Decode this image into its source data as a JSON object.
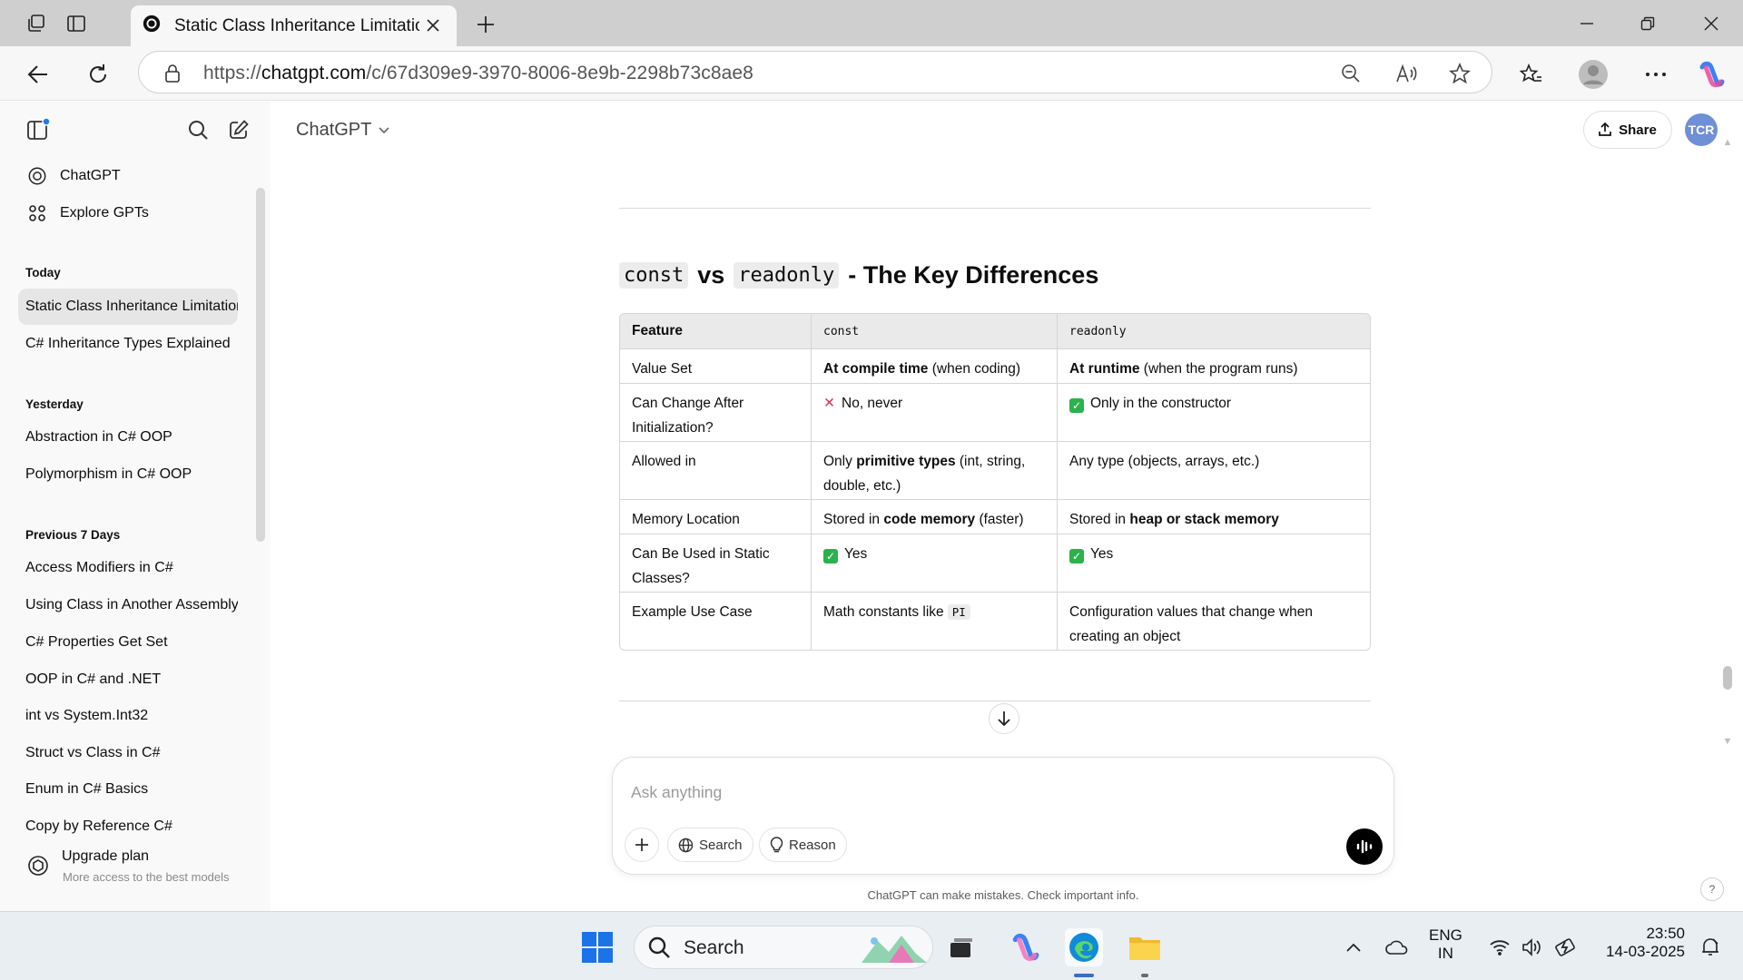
{
  "browser": {
    "tab_title": "Static Class Inheritance Limitation",
    "url_prefix": "https://",
    "url_host": "chatgpt.com",
    "url_path": "/c/67d309e9-3970-8006-8e9b-2298b73c8ae8"
  },
  "sidebar": {
    "nav": [
      {
        "label": "ChatGPT",
        "icon": "openai-logo-icon"
      },
      {
        "label": "Explore GPTs",
        "icon": "grid-icon"
      }
    ],
    "sections": [
      {
        "title": "Today",
        "items": [
          "Static Class Inheritance Limitation",
          "C# Inheritance Types Explained"
        ]
      },
      {
        "title": "Yesterday",
        "items": [
          "Abstraction in C# OOP",
          "Polymorphism in C# OOP"
        ]
      },
      {
        "title": "Previous 7 Days",
        "items": [
          "Access Modifiers in C#",
          "Using Class in Another Assembly",
          "C# Properties Get Set",
          "OOP in C# and .NET",
          "int vs System.Int32",
          "Struct vs Class in C#",
          "Enum in C# Basics",
          "Copy by Reference C#"
        ]
      }
    ],
    "upgrade_title": "Upgrade plan",
    "upgrade_sub": "More access to the best models"
  },
  "header": {
    "model": "ChatGPT",
    "share": "Share",
    "avatar": "TCR"
  },
  "content": {
    "heading_code1": "const",
    "heading_vs": "vs",
    "heading_code2": "readonly",
    "heading_rest": "- The Key Differences",
    "table": {
      "headers": [
        "Feature",
        "const",
        "readonly"
      ],
      "rows": [
        {
          "feature": "Value Set",
          "const_bold": "At compile time",
          "const_text": " (when coding)",
          "readonly_bold": "At runtime",
          "readonly_text": " (when the program runs)"
        },
        {
          "feature": "Can Change After Initialization?",
          "const_text": "No, never",
          "readonly_text": "Only in the constructor"
        },
        {
          "feature": "Allowed in",
          "const_pre": "Only ",
          "const_bold": "primitive types",
          "const_text": " (int, string, double, etc.)",
          "readonly_text": "Any type (objects, arrays, etc.)"
        },
        {
          "feature": "Memory Location",
          "const_pre": "Stored in ",
          "const_bold": "code memory",
          "const_text": " (faster)",
          "readonly_pre": "Stored in ",
          "readonly_bold": "heap or stack memory"
        },
        {
          "feature": "Can Be Used in Static Classes?",
          "const_text": "Yes",
          "readonly_text": "Yes"
        },
        {
          "feature": "Example Use Case",
          "const_text": "Math constants like",
          "const_code": "PI",
          "readonly_text": "Configuration values that change when creating an object"
        }
      ]
    }
  },
  "composer": {
    "placeholder": "Ask anything",
    "search": "Search",
    "reason": "Reason",
    "disclaimer": "ChatGPT can make mistakes. Check important info.",
    "help": "?"
  },
  "taskbar": {
    "search": "Search",
    "lang1": "ENG",
    "lang2": "IN",
    "time": "23:50",
    "date": "14-03-2025"
  }
}
